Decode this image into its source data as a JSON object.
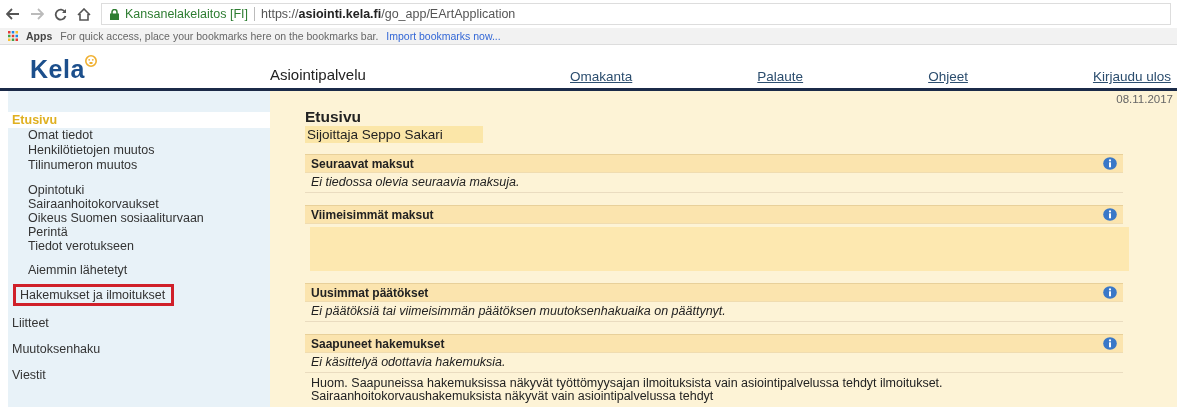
{
  "browser": {
    "site_name": "Kansanelakelaitos [FI]",
    "url": "https://**asiointi.kela.fi**/go_app/EArtApplication",
    "bookmarks_apps": "Apps",
    "bookmarks_hint": "For quick access, place your bookmarks here on the bookmarks bar.",
    "bookmarks_import": "Import bookmarks now..."
  },
  "header": {
    "logo": "Kela",
    "title": "Asiointipalvelu",
    "links": [
      "Omakanta",
      "Palaute",
      "Ohjeet",
      "Kirjaudu ulos"
    ]
  },
  "sidebar": {
    "items": [
      {
        "label": "Etusivu",
        "selected": true,
        "outlined": false,
        "child_groups": [
          [
            "Omat tiedot",
            "Henkilötietojen muutos",
            "Tilinumeron muutos"
          ],
          [
            "Opintotuki",
            "Sairaanhoitokorvaukset",
            "Oikeus Suomen sosiaaliturvaan",
            "Perintä",
            "Tiedot verotukseen"
          ],
          [
            "Aiemmin lähetetyt"
          ]
        ]
      },
      {
        "label": "Hakemukset ja ilmoitukset",
        "selected": false,
        "outlined": true
      },
      {
        "label": "Liitteet",
        "selected": false,
        "outlined": false
      },
      {
        "label": "Muutoksenhaku",
        "selected": false,
        "outlined": false
      },
      {
        "label": "Viestit",
        "selected": false,
        "outlined": false
      }
    ]
  },
  "main": {
    "date": "08.11.2017",
    "heading": "Etusivu",
    "user": "Sijoittaja Seppo Sakari",
    "sections": [
      {
        "title": "Seuraavat maksut",
        "kind": "message",
        "body": "Ei tiedossa olevia seuraavia maksuja."
      },
      {
        "title": "Viimeisimmät maksut",
        "kind": "empty"
      },
      {
        "title": "Uusimmat päätökset",
        "kind": "message",
        "body": "Ei päätöksiä tai viimeisimmän päätöksen muutoksenhakuaika on päättynyt."
      },
      {
        "title": "Saapuneet hakemukset",
        "kind": "message",
        "body": "Ei käsittelyä odottavia hakemuksia."
      }
    ],
    "note": "Huom. Saapuneissa hakemuksissa näkyvät työttömyysajan ilmoituksista vain asiointipalvelussa tehdyt ilmoitukset. Sairaanhoitokorvaushakemuksista näkyvät vain asiointipalvelussa tehdyt"
  }
}
